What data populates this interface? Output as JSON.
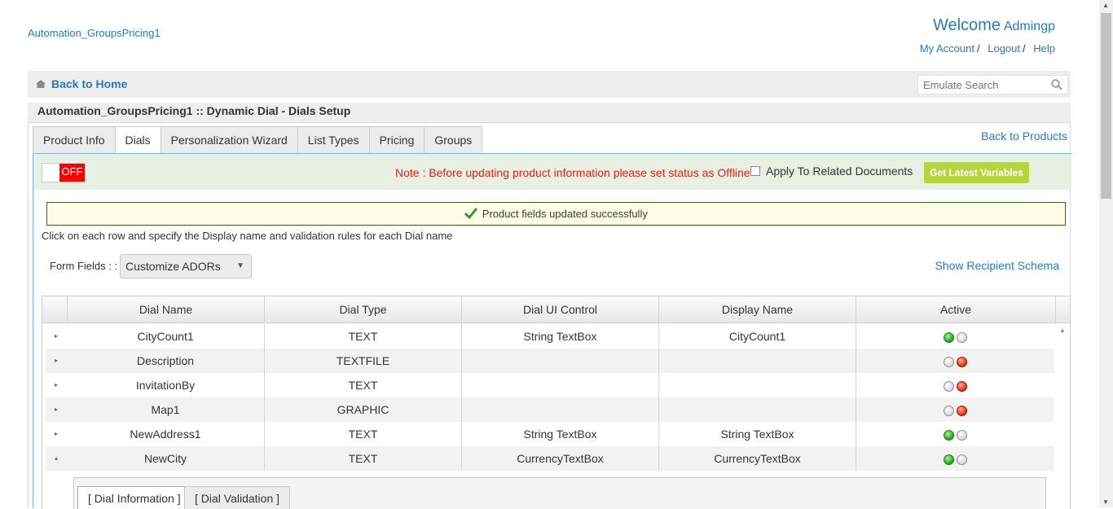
{
  "header": {
    "site_name": "Automation_GroupsPricing1",
    "welcome_label": "Welcome",
    "user_name": "Admingp",
    "links": {
      "my_account": "My Account",
      "logout": "Logout",
      "help": "Help",
      "separator": "/"
    }
  },
  "navbar": {
    "back_home": "Back to Home",
    "search_placeholder": "Emulate Search"
  },
  "page_title": "Automation_GroupsPricing1 :: Dynamic Dial - Dials Setup",
  "tabs": [
    {
      "label": "Product Info",
      "active": false
    },
    {
      "label": "Dials",
      "active": true
    },
    {
      "label": "Personalization Wizard",
      "active": false
    },
    {
      "label": "List Types",
      "active": false
    },
    {
      "label": "Pricing",
      "active": false
    },
    {
      "label": "Groups",
      "active": false
    }
  ],
  "back_to_products": "Back to Products",
  "status_strip": {
    "toggle_label": "OFF",
    "note": "Note : Before updating product information please set status as Offline",
    "apply_related": "Apply To Related Documents",
    "get_latest": "Get Latest Variables"
  },
  "success_message": "Product fields updated successfully",
  "instructions": "Click on each row and specify the Display name and validation rules for each Dial name",
  "form_fields": {
    "label": "Form Fields : :",
    "selected": "Customize ADORs",
    "caret": "▼"
  },
  "show_schema": "Show Recipient Schema",
  "grid": {
    "columns": [
      "Dial Name",
      "Dial Type",
      "Dial UI Control",
      "Display Name",
      "Active"
    ],
    "rows": [
      {
        "expander": "▸",
        "name": "CityCount1",
        "type": "TEXT",
        "ui_control": "String TextBox",
        "display": "CityCount1",
        "active": true
      },
      {
        "expander": "▸",
        "name": "Description",
        "type": "TEXTFILE",
        "ui_control": "",
        "display": "",
        "active": false
      },
      {
        "expander": "▸",
        "name": "InvitationBy",
        "type": "TEXT",
        "ui_control": "",
        "display": "",
        "active": false
      },
      {
        "expander": "▸",
        "name": "Map1",
        "type": "GRAPHIC",
        "ui_control": "",
        "display": "",
        "active": false
      },
      {
        "expander": "▸",
        "name": "NewAddress1",
        "type": "TEXT",
        "ui_control": "String TextBox",
        "display": "String TextBox",
        "active": true
      },
      {
        "expander": "▴",
        "name": "NewCity",
        "type": "TEXT",
        "ui_control": "CurrencyTextBox",
        "display": "CurrencyTextBox",
        "active": true
      }
    ]
  },
  "detail_tabs": [
    {
      "label": "[ Dial Information ]",
      "active": true
    },
    {
      "label": "[ Dial Validation ]",
      "active": false
    }
  ],
  "colors": {
    "link": "#2a7ab8",
    "toggle_off": "#ff0000",
    "note": "#e2231a",
    "get_latest": "#b7d53b",
    "status_strip": "#e7f0e2",
    "active_on": "#19a21a",
    "active_off": "#e0250f"
  },
  "icons": {
    "home": "home-icon",
    "search": "search-icon",
    "check": "check-icon"
  }
}
